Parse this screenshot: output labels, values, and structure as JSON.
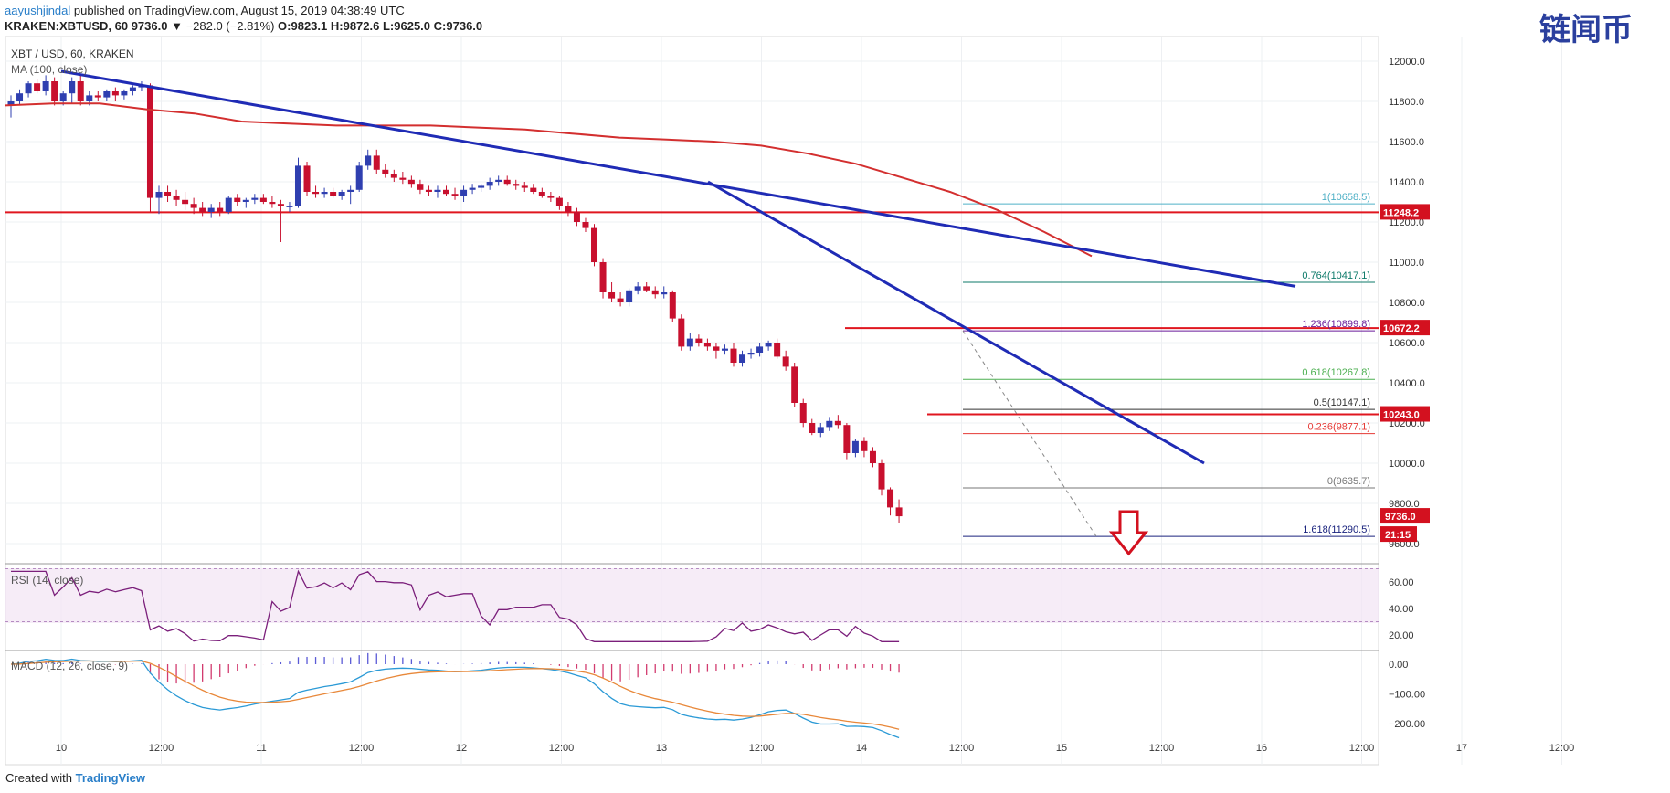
{
  "header": {
    "author": "aayushjindal",
    "published_text": "published on TradingView.com, August 15, 2019 04:38:49 UTC",
    "symbol_line": "KRAKEN:XBTUSD, 60",
    "last": "9736.0",
    "change": "▼ −282.0 (−2.81%)",
    "o": "O:9823.1",
    "h": "H:9872.6",
    "l": "L:9625.0",
    "c": "C:9736.0"
  },
  "legend": {
    "pair": "XBT / USD, 60, KRAKEN",
    "ma": "MA (100, close)",
    "rsi": "RSI (14, close)",
    "macd": "MACD (12, 26, close, 9)"
  },
  "watermark": "链闻币",
  "footer": {
    "created_with": "Created with",
    "brand": "TradingView"
  },
  "price_labels": {
    "level_11248": "11248.2",
    "level_10672": "10672.2",
    "level_10243": "10243.0",
    "last_price": "9736.0",
    "countdown": "21:15"
  },
  "fib_labels": [
    "1.618(11290.5)",
    "1.236(10899.8)",
    "1(10658.5)",
    "0.764(10417.1)",
    "0.618(10267.8)",
    "0.5(10147.1)",
    "0.236(9877.1)",
    "0(9635.7)"
  ],
  "colors": {
    "up": "#2f3fb0",
    "down": "#c8102e",
    "ma": "#d32f2f",
    "trend": "#1f2bb5",
    "rsi": "#7b1f7b",
    "macd": "#2b9ad6",
    "signal": "#e8883a"
  },
  "chart_data": {
    "type": "candlestick",
    "title": "XBT / USD, 60, KRAKEN",
    "main_ylim": [
      9500,
      12100
    ],
    "y_ticks": [
      "12000.0",
      "11800.0",
      "11600.0",
      "11400.0",
      "11200.0",
      "11000.0",
      "10800.0",
      "10600.0",
      "10400.0",
      "10200.0",
      "10000.0",
      "9800.0",
      "9600.0"
    ],
    "x_ticks": [
      "10",
      "12:00",
      "11",
      "12:00",
      "12",
      "12:00",
      "13",
      "12:00",
      "14",
      "12:00",
      "15",
      "12:00",
      "16",
      "12:00",
      "17",
      "12:00"
    ],
    "candles_ohlc": [
      [
        11780,
        11830,
        11720,
        11800
      ],
      [
        11800,
        11860,
        11780,
        11840
      ],
      [
        11840,
        11900,
        11820,
        11890
      ],
      [
        11890,
        11910,
        11840,
        11850
      ],
      [
        11850,
        11930,
        11830,
        11900
      ],
      [
        11900,
        11920,
        11780,
        11800
      ],
      [
        11800,
        11850,
        11780,
        11840
      ],
      [
        11840,
        11920,
        11790,
        11900
      ],
      [
        11900,
        11930,
        11780,
        11800
      ],
      [
        11800,
        11850,
        11780,
        11830
      ],
      [
        11830,
        11850,
        11800,
        11820
      ],
      [
        11820,
        11860,
        11800,
        11850
      ],
      [
        11850,
        11870,
        11800,
        11830
      ],
      [
        11830,
        11860,
        11810,
        11850
      ],
      [
        11850,
        11880,
        11830,
        11870
      ],
      [
        11870,
        11900,
        11850,
        11880
      ],
      [
        11880,
        11890,
        11250,
        11320
      ],
      [
        11320,
        11380,
        11240,
        11350
      ],
      [
        11350,
        11380,
        11300,
        11330
      ],
      [
        11330,
        11360,
        11280,
        11310
      ],
      [
        11310,
        11350,
        11260,
        11290
      ],
      [
        11290,
        11320,
        11240,
        11270
      ],
      [
        11270,
        11300,
        11230,
        11250
      ],
      [
        11250,
        11290,
        11220,
        11270
      ],
      [
        11270,
        11300,
        11230,
        11250
      ],
      [
        11250,
        11330,
        11240,
        11320
      ],
      [
        11320,
        11340,
        11280,
        11300
      ],
      [
        11300,
        11320,
        11270,
        11310
      ],
      [
        11310,
        11340,
        11290,
        11320
      ],
      [
        11320,
        11340,
        11290,
        11300
      ],
      [
        11300,
        11330,
        11270,
        11290
      ],
      [
        11290,
        11310,
        11100,
        11280
      ],
      [
        11280,
        11300,
        11250,
        11280
      ],
      [
        11280,
        11520,
        11270,
        11480
      ],
      [
        11480,
        11500,
        11330,
        11350
      ],
      [
        11350,
        11380,
        11320,
        11340
      ],
      [
        11340,
        11370,
        11320,
        11350
      ],
      [
        11350,
        11370,
        11320,
        11330
      ],
      [
        11330,
        11360,
        11310,
        11350
      ],
      [
        11350,
        11380,
        11290,
        11360
      ],
      [
        11360,
        11500,
        11350,
        11480
      ],
      [
        11480,
        11560,
        11460,
        11530
      ],
      [
        11530,
        11560,
        11440,
        11460
      ],
      [
        11460,
        11490,
        11420,
        11440
      ],
      [
        11440,
        11460,
        11400,
        11420
      ],
      [
        11420,
        11450,
        11390,
        11410
      ],
      [
        11410,
        11430,
        11370,
        11390
      ],
      [
        11390,
        11410,
        11340,
        11360
      ],
      [
        11360,
        11380,
        11330,
        11350
      ],
      [
        11350,
        11380,
        11320,
        11360
      ],
      [
        11360,
        11380,
        11330,
        11340
      ],
      [
        11340,
        11370,
        11310,
        11330
      ],
      [
        11330,
        11380,
        11300,
        11360
      ],
      [
        11360,
        11390,
        11340,
        11370
      ],
      [
        11370,
        11390,
        11350,
        11380
      ],
      [
        11380,
        11420,
        11360,
        11400
      ],
      [
        11400,
        11430,
        11380,
        11410
      ],
      [
        11410,
        11430,
        11380,
        11390
      ],
      [
        11390,
        11410,
        11360,
        11380
      ],
      [
        11380,
        11400,
        11350,
        11370
      ],
      [
        11370,
        11390,
        11340,
        11350
      ],
      [
        11350,
        11370,
        11320,
        11330
      ],
      [
        11330,
        11350,
        11300,
        11320
      ],
      [
        11320,
        11330,
        11260,
        11280
      ],
      [
        11280,
        11300,
        11230,
        11250
      ],
      [
        11250,
        11270,
        11180,
        11200
      ],
      [
        11200,
        11220,
        11150,
        11170
      ],
      [
        11170,
        11190,
        10980,
        11000
      ],
      [
        11000,
        11020,
        10820,
        10850
      ],
      [
        10850,
        10900,
        10800,
        10820
      ],
      [
        10820,
        10850,
        10780,
        10800
      ],
      [
        10800,
        10870,
        10780,
        10860
      ],
      [
        10860,
        10900,
        10840,
        10880
      ],
      [
        10880,
        10900,
        10850,
        10860
      ],
      [
        10860,
        10880,
        10820,
        10840
      ],
      [
        10840,
        10880,
        10820,
        10850
      ],
      [
        10850,
        10860,
        10700,
        10720
      ],
      [
        10720,
        10740,
        10560,
        10580
      ],
      [
        10580,
        10650,
        10560,
        10620
      ],
      [
        10620,
        10640,
        10580,
        10600
      ],
      [
        10600,
        10620,
        10560,
        10580
      ],
      [
        10580,
        10600,
        10520,
        10560
      ],
      [
        10560,
        10590,
        10540,
        10570
      ],
      [
        10570,
        10600,
        10480,
        10500
      ],
      [
        10500,
        10560,
        10480,
        10540
      ],
      [
        10540,
        10570,
        10520,
        10550
      ],
      [
        10550,
        10600,
        10530,
        10580
      ],
      [
        10580,
        10610,
        10560,
        10600
      ],
      [
        10600,
        10620,
        10520,
        10530
      ],
      [
        10530,
        10560,
        10460,
        10480
      ],
      [
        10480,
        10500,
        10280,
        10300
      ],
      [
        10300,
        10320,
        10180,
        10200
      ],
      [
        10200,
        10220,
        10140,
        10150
      ],
      [
        10150,
        10200,
        10130,
        10180
      ],
      [
        10180,
        10230,
        10160,
        10210
      ],
      [
        10210,
        10240,
        10170,
        10190
      ],
      [
        10190,
        10200,
        10020,
        10050
      ],
      [
        10050,
        10120,
        10030,
        10110
      ],
      [
        10110,
        10130,
        10030,
        10060
      ],
      [
        10060,
        10080,
        9980,
        10000
      ],
      [
        10000,
        10020,
        9840,
        9870
      ],
      [
        9870,
        9880,
        9740,
        9780
      ],
      [
        9780,
        9820,
        9700,
        9736
      ]
    ],
    "ma_100": [
      11780,
      11790,
      11790,
      11760,
      11740,
      11700,
      11690,
      11680,
      11680,
      11680,
      11670,
      11660,
      11640,
      11620,
      11610,
      11600,
      11580,
      11540,
      11490,
      11420,
      11350,
      11260,
      11150,
      11030
    ],
    "levels": [
      11248.2,
      10672.2,
      10243.0
    ],
    "fibonacci": {
      "1.618": 11290.5,
      "1.236": 10899.8,
      "1": 10658.5,
      "0.764": 10417.1,
      "0.618": 10267.8,
      "0.5": 10147.1,
      "0.236": 9877.1,
      "0": 9635.7
    },
    "rsi": {
      "ylim": [
        0,
        80
      ],
      "ticks": [
        "60.00",
        "40.00",
        "20.00"
      ],
      "bands": [
        70,
        30
      ]
    },
    "macd": {
      "ylim": [
        -250,
        50
      ],
      "ticks": [
        "0.00",
        "−100.00",
        "−200.00"
      ]
    }
  }
}
